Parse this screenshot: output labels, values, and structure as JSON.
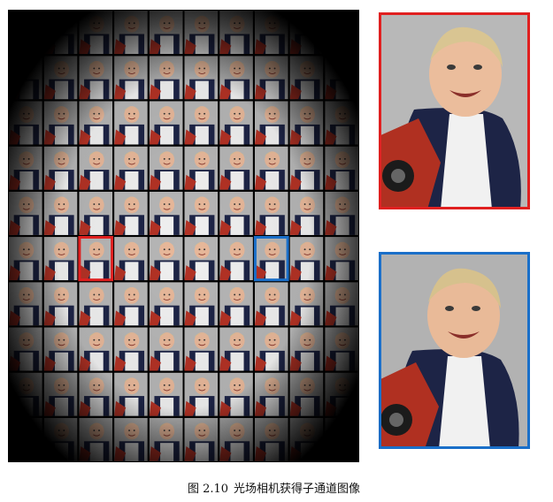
{
  "figure": {
    "caption_label": "图 2.10",
    "caption_text": "光场相机获得子通道图像"
  },
  "lightfield": {
    "grid_cols": 10,
    "grid_rows": 10,
    "highlight_red": {
      "row": 5,
      "col": 2
    },
    "highlight_blue": {
      "row": 5,
      "col": 7
    }
  },
  "colors": {
    "red_highlight": "#e02020",
    "blue_highlight": "#1a6fc9",
    "background": "#000000",
    "wall": "#b3b3b3",
    "shirt": "#1d2446",
    "skin": "#e8b89a",
    "hair": "#d7c090",
    "toy": "#b33225"
  }
}
